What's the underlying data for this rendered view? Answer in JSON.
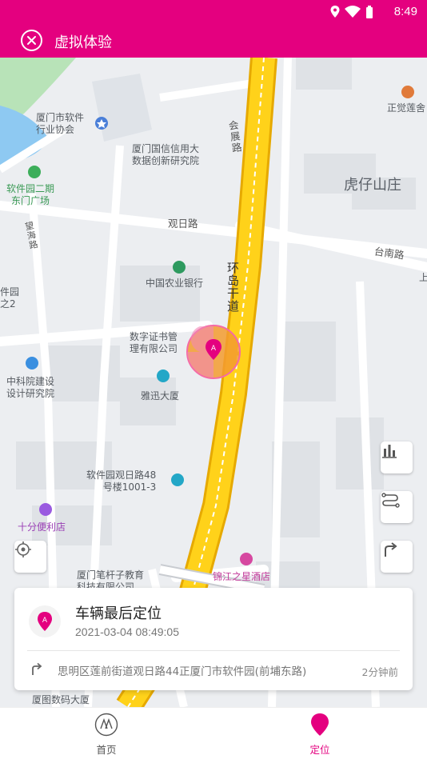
{
  "status_bar": {
    "time": "8:49"
  },
  "header": {
    "title": "虚拟体验"
  },
  "map_labels": {
    "software_assoc": "厦门市软件\n行业协会",
    "zhengjue": "正觉莲舍",
    "huizhan_road": "会\n展\n路",
    "guoxin": "厦门国信信用大\n数据创新研究院",
    "huzaishan": "虎仔山庄",
    "software_park_plaza": "软件园二期\n东门广场",
    "guanri_road": "观日路",
    "tainan_road": "台南路",
    "wanghai_road": "望\n海\n路",
    "abc_bank": "中国农业银行",
    "huandao_road": "环\n岛\n干\n道",
    "software_park_left": "件园\n之2",
    "digital_cert": "数字证书管\n理有限公司",
    "cas_institute": "中科院建设\n设计研究院",
    "yaxun": "雅迅大厦",
    "guanri48": "软件园观日路48\n号楼1001-3",
    "shifen": "十分便利店",
    "bikanzi": "厦门笔杆子教育\n科技有限公司",
    "jinjiang": "锦江之星酒店",
    "shang": "上",
    "bottom_left": "厦图数码大厦"
  },
  "card": {
    "title": "车辆最后定位",
    "time": "2021-03-04 08:49:05",
    "address": "思明区莲前街道观日路44正厦门市软件园(前埔东路)",
    "ago": "2分钟前"
  },
  "nav": {
    "home": "首页",
    "location": "定位"
  },
  "colors": {
    "brand": "#e4007f",
    "road_main": "#ffd21a",
    "road_border": "#e0a800"
  }
}
